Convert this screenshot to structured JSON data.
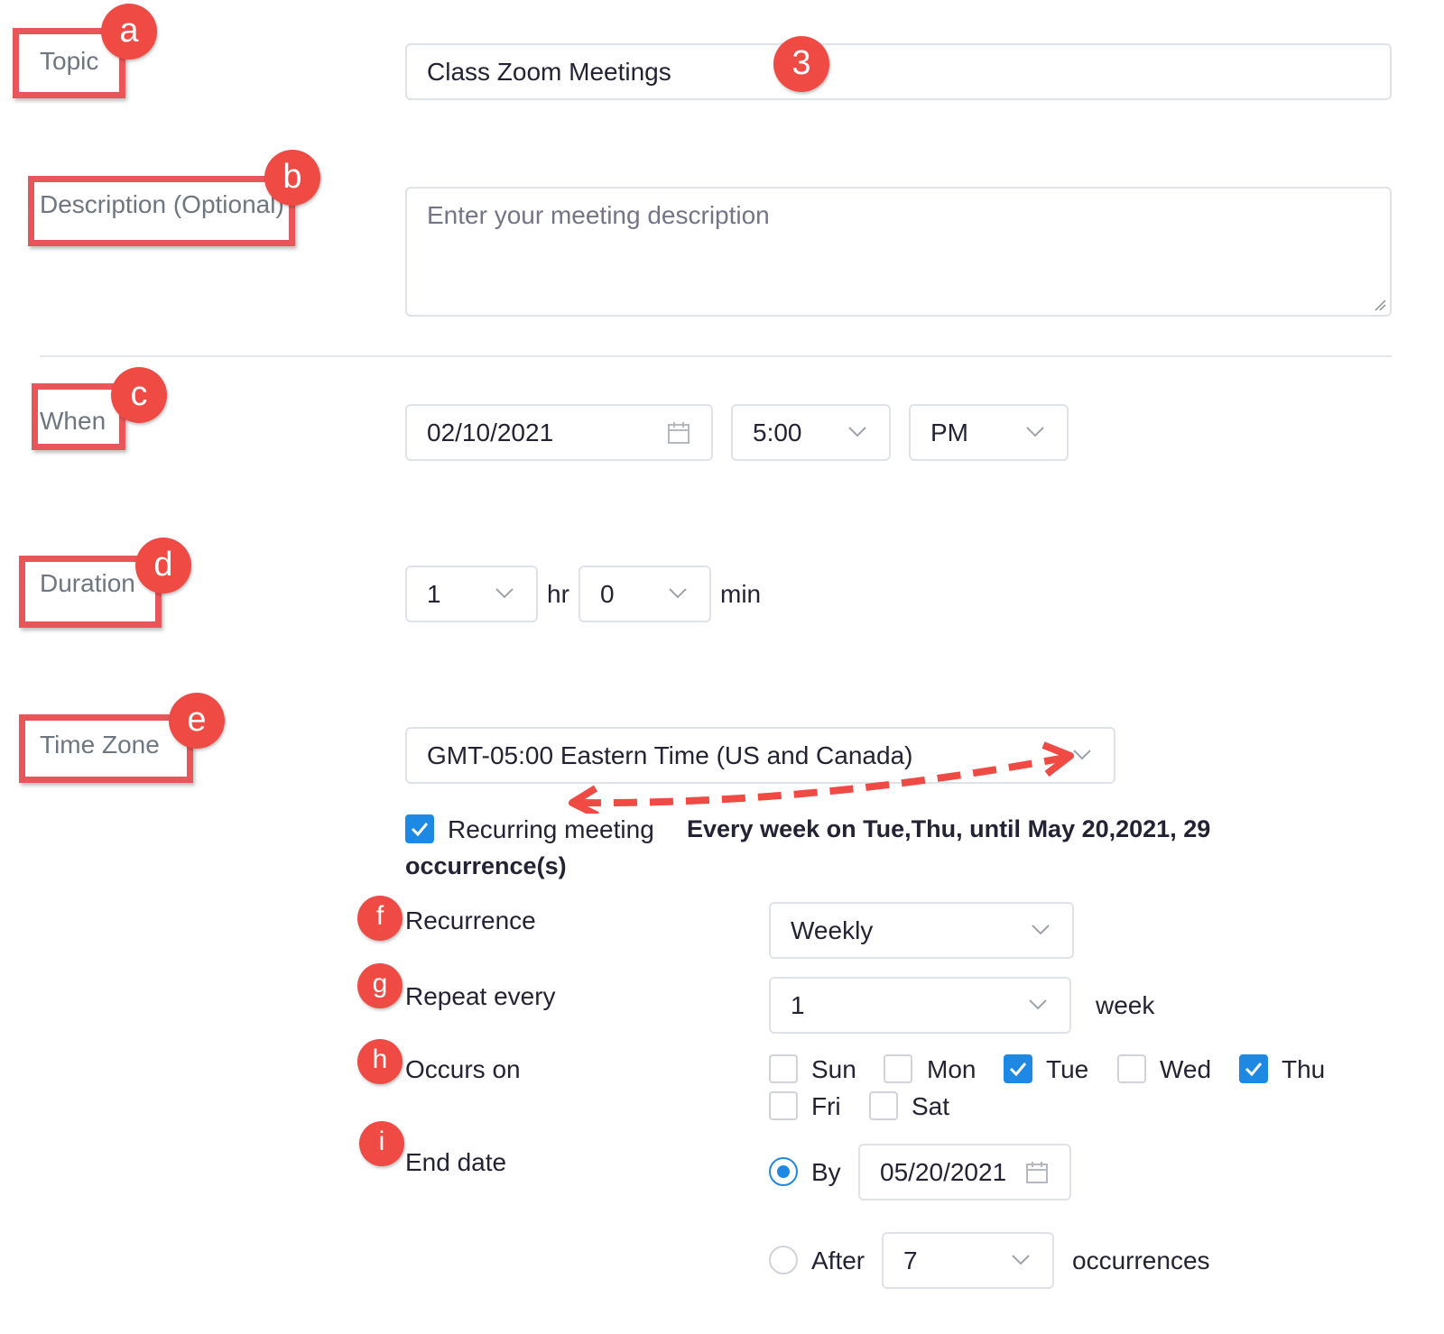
{
  "labels": {
    "topic": "Topic",
    "description": "Description (Optional)",
    "when": "When",
    "duration": "Duration",
    "time_zone": "Time Zone",
    "recurrence": "Recurrence",
    "repeat_every": "Repeat every",
    "occurs_on": "Occurs on",
    "end_date": "End date"
  },
  "badges": {
    "a": "a",
    "b": "b",
    "c": "c",
    "d": "d",
    "e": "e",
    "f": "f",
    "g": "g",
    "h": "h",
    "i": "i",
    "three": "3"
  },
  "topic": {
    "value": "Class Zoom Meetings"
  },
  "description": {
    "placeholder": "Enter your meeting description"
  },
  "when": {
    "date": "02/10/2021",
    "time": "5:00",
    "ampm": "PM"
  },
  "duration": {
    "hours": "1",
    "hours_unit": "hr",
    "minutes": "0",
    "minutes_unit": "min"
  },
  "time_zone": {
    "value": "GMT-05:00 Eastern Time (US and Canada)"
  },
  "recurring": {
    "checked": true,
    "label": "Recurring meeting",
    "summary_line1": "Every week on Tue,Thu, until May 20,2021, 29",
    "summary_line2": "occurrence(s)"
  },
  "recurrence": {
    "value": "Weekly"
  },
  "repeat_every": {
    "value": "1",
    "unit": "week"
  },
  "occurs_on": {
    "days": [
      {
        "label": "Sun",
        "checked": false
      },
      {
        "label": "Mon",
        "checked": false
      },
      {
        "label": "Tue",
        "checked": true
      },
      {
        "label": "Wed",
        "checked": false
      },
      {
        "label": "Thu",
        "checked": true
      },
      {
        "label": "Fri",
        "checked": false
      },
      {
        "label": "Sat",
        "checked": false
      }
    ]
  },
  "end_date": {
    "by_label": "By",
    "by_selected": true,
    "by_date": "05/20/2021",
    "after_label": "After",
    "after_value": "7",
    "after_unit": "occurrences"
  },
  "colors": {
    "annotation_red": "#ef4a43",
    "checkbox_blue": "#1e88e5",
    "label_gray": "#6e7680"
  },
  "icons": [
    "calendar-icon",
    "chevron-down-icon",
    "check-icon",
    "dashed-double-arrow"
  ]
}
